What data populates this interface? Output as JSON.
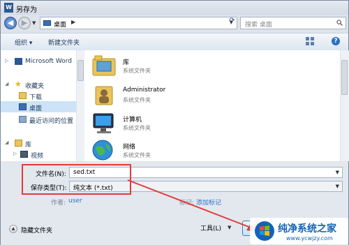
{
  "window": {
    "title": "另存为"
  },
  "navbar": {
    "address": "桌面",
    "search_placeholder": "搜索 桌面"
  },
  "toolbar": {
    "organize": "组织 ▾",
    "new_folder": "新建文件夹"
  },
  "nav_pane": {
    "items": [
      {
        "label": "Microsoft Word",
        "icon": "word-icon"
      },
      {
        "label": "收藏夹",
        "icon": "favorites-star-icon"
      },
      {
        "label": "下载",
        "icon": "download-folder-icon"
      },
      {
        "label": "桌面",
        "icon": "desktop-icon",
        "selected": true
      },
      {
        "label": "最近访问的位置",
        "icon": "recent-places-icon"
      },
      {
        "label": "库",
        "icon": "library-icon"
      },
      {
        "label": "视频",
        "icon": "video-icon"
      }
    ]
  },
  "files": [
    {
      "name": "库",
      "type": "系统文件夹",
      "icon": "library-folder-icon"
    },
    {
      "name": "Administrator",
      "type": "系统文件夹",
      "icon": "user-folder-icon"
    },
    {
      "name": "计算机",
      "type": "系统文件夹",
      "icon": "computer-icon"
    },
    {
      "name": "网络",
      "type": "系统文件夹",
      "icon": "network-globe-icon"
    }
  ],
  "form": {
    "filename_label": "文件名(N):",
    "filename_value": "sed.txt",
    "filetype_label": "保存类型(T):",
    "filetype_value": "纯文本 (*.txt)",
    "author_label": "作者:",
    "author_value": "user",
    "tags_label": "标记:",
    "tags_value": "添加标记"
  },
  "footer": {
    "hide_folders": "隐藏文件夹",
    "tools": "工具(L)"
  },
  "watermark": {
    "name": "纯净系统之家",
    "url": "www.ycwjzy.com"
  },
  "colors": {
    "annotation": "#e23b3b",
    "selection": "#cce3f8",
    "link": "#2b6fc8"
  }
}
